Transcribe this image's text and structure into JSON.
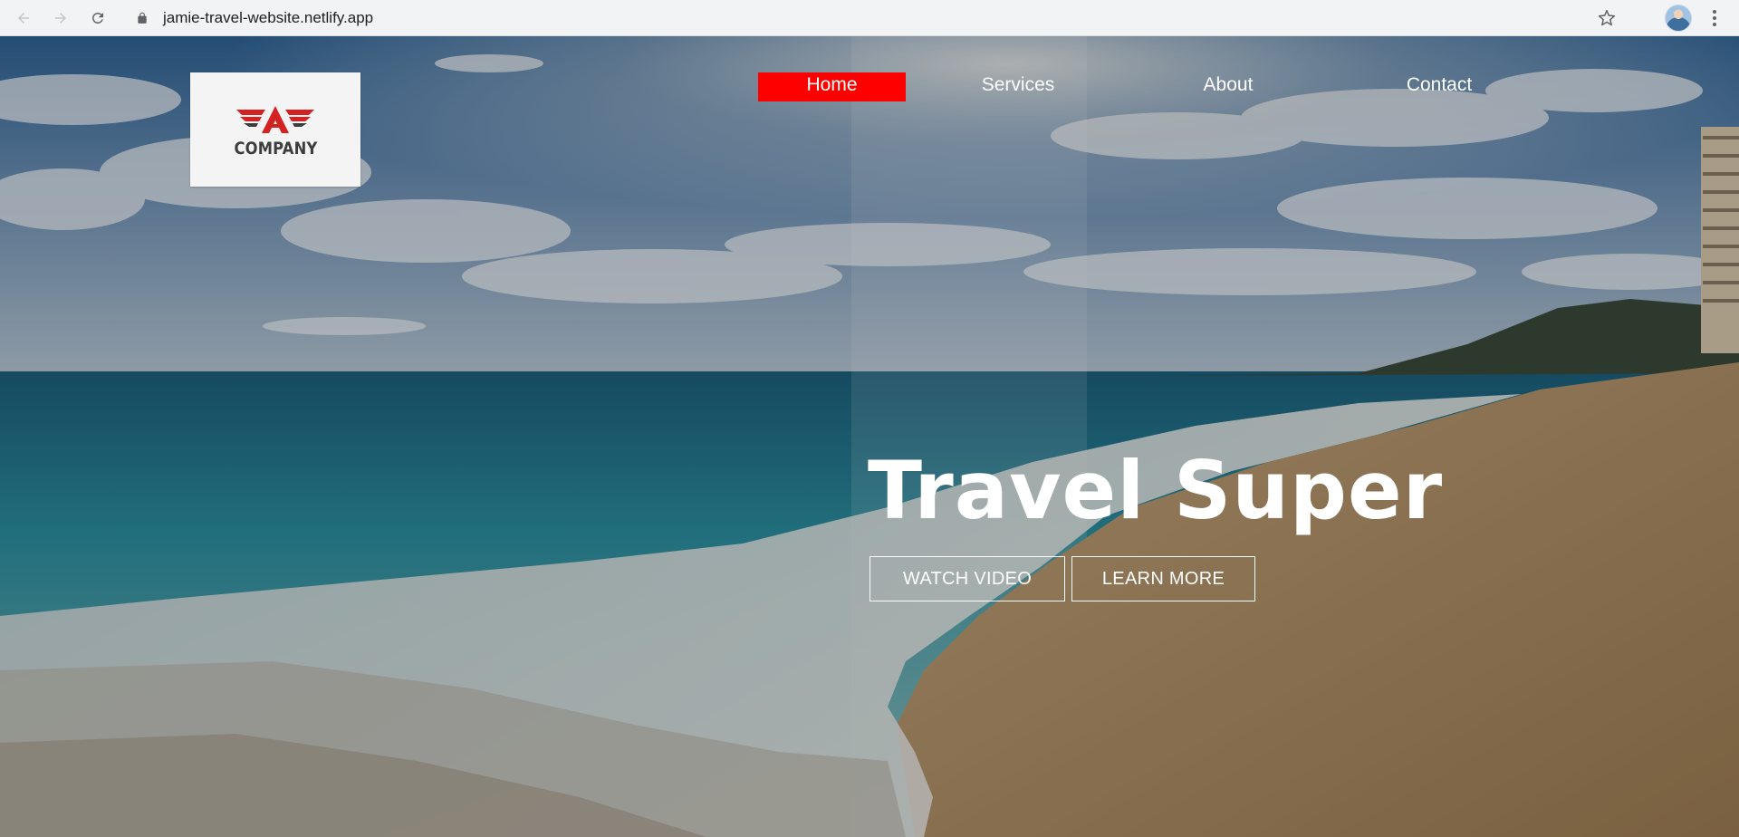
{
  "browser": {
    "url": "jamie-travel-website.netlify.app"
  },
  "logo": {
    "text": "COMPANY",
    "colors": {
      "wing": "#d32222",
      "dark": "#3d3d3d"
    }
  },
  "nav": {
    "items": [
      {
        "label": "Home",
        "active": true
      },
      {
        "label": "Services",
        "active": false
      },
      {
        "label": "About",
        "active": false
      },
      {
        "label": "Contact",
        "active": false
      }
    ],
    "active_color": "#ff0000"
  },
  "hero": {
    "title": "Travel Super",
    "buttons": {
      "watch_video": "WATCH VIDEO",
      "learn_more": "LEARN MORE"
    }
  }
}
